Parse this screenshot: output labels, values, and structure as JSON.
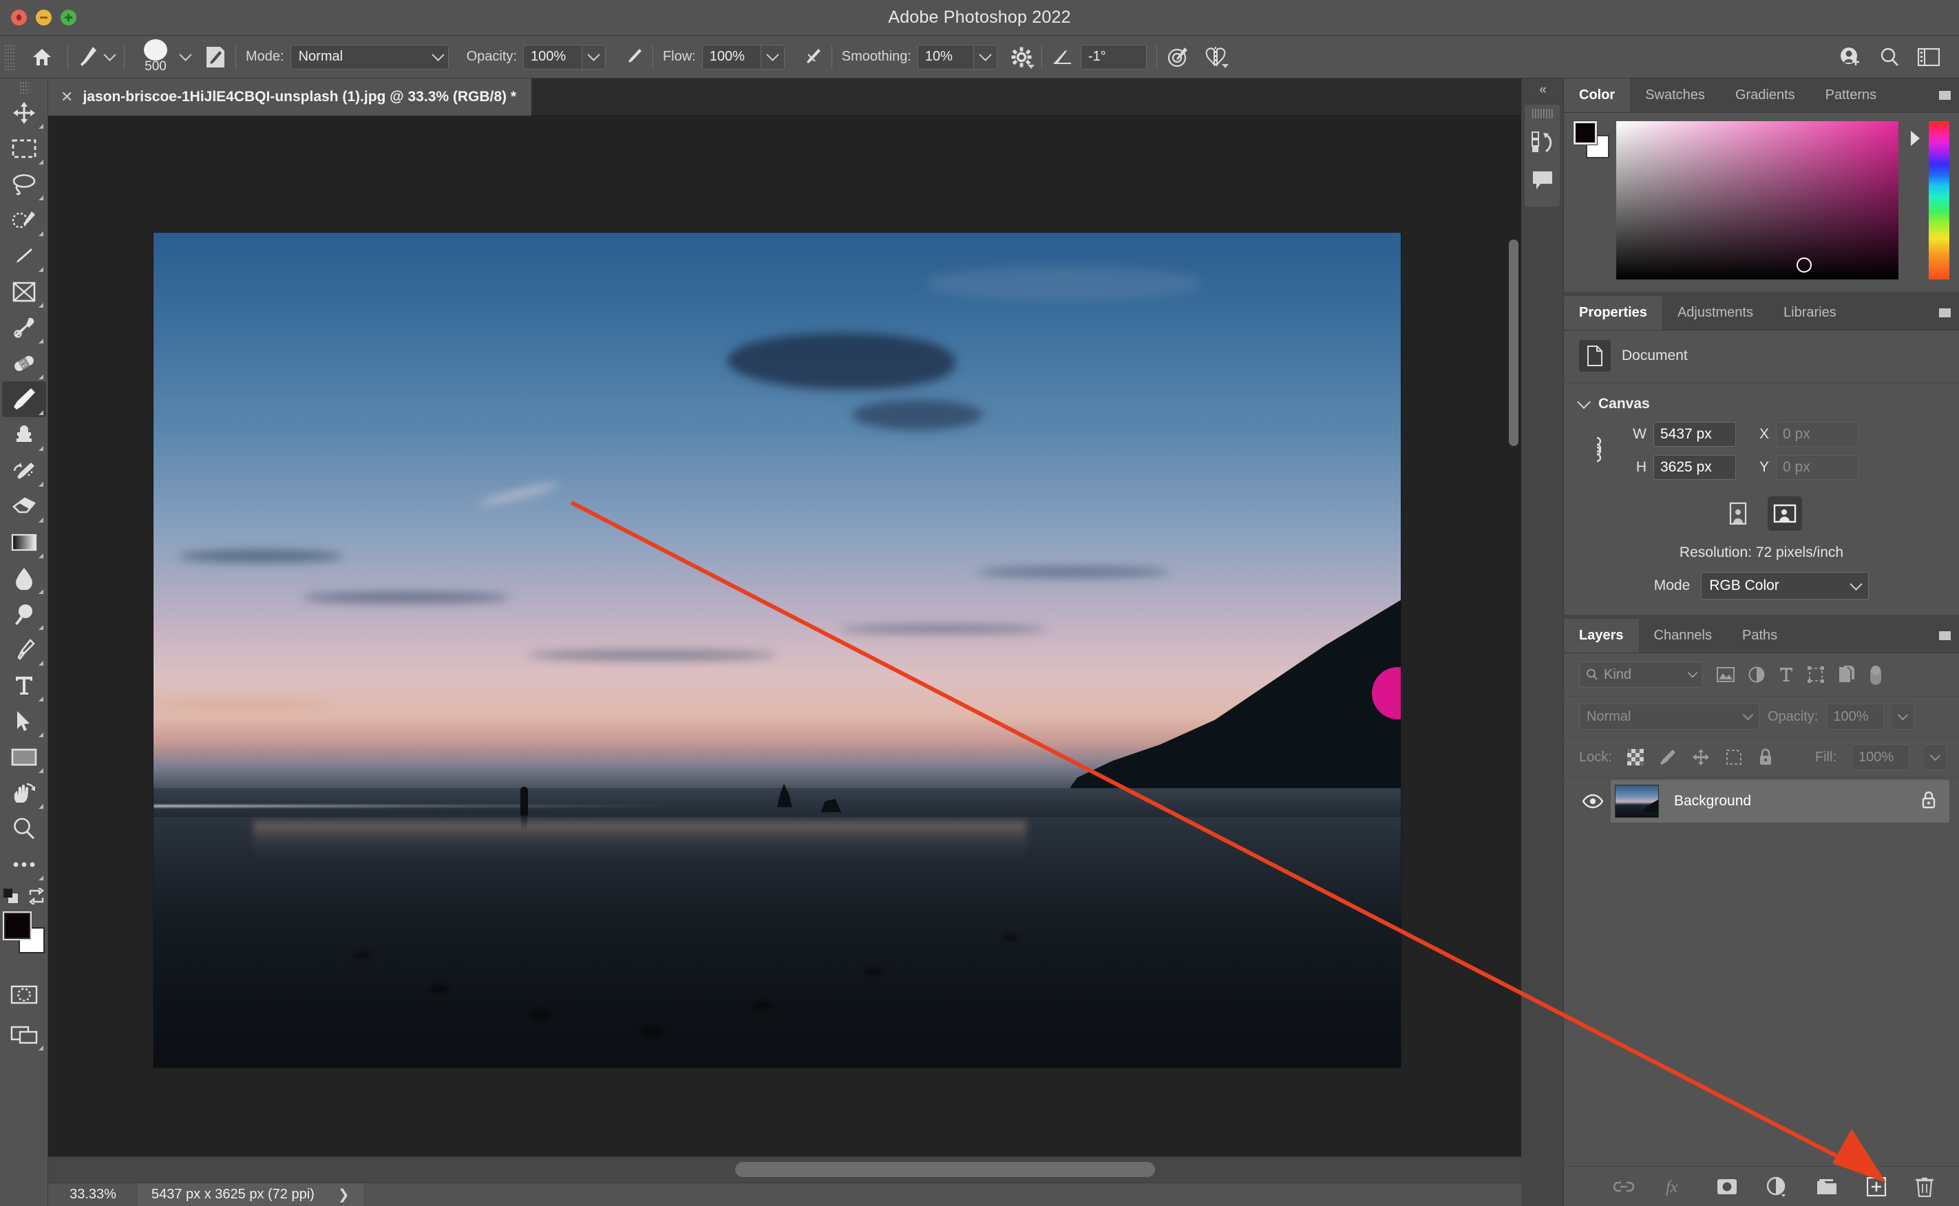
{
  "window": {
    "title": "Adobe Photoshop 2022",
    "controls": [
      "close",
      "minimize",
      "zoom"
    ]
  },
  "options_bar": {
    "home_icon": "home-icon",
    "brush_preset_icon": "brush-preset-icon",
    "brush_size": "500",
    "brush_panel_icon": "brush-settings-panel-icon",
    "mode_label": "Mode:",
    "mode_value": "Normal",
    "opacity_label": "Opacity:",
    "opacity_value": "100%",
    "pressure_opacity_icon": "pressure-opacity-icon",
    "flow_label": "Flow:",
    "flow_value": "100%",
    "airbrush_icon": "airbrush-icon",
    "smoothing_label": "Smoothing:",
    "smoothing_value": "10%",
    "smoothing_gear_icon": "smoothing-options-gear-icon",
    "angle_icon": "brush-angle-icon",
    "angle_value": "-1°",
    "pressure_size_icon": "pressure-size-icon",
    "symmetry_icon": "symmetry-butterfly-icon",
    "right_icons": [
      "share-add-user-icon",
      "search-icon",
      "workspace-switcher-icon"
    ]
  },
  "toolbar": {
    "tools": [
      {
        "name": "move-tool",
        "icon": "move-icon"
      },
      {
        "name": "rectangular-marquee-tool",
        "icon": "marquee-icon"
      },
      {
        "name": "lasso-tool",
        "icon": "lasso-icon"
      },
      {
        "name": "object-selection-tool",
        "icon": "quick-selection-icon"
      },
      {
        "name": "crop-tool",
        "icon": "crop-icon"
      },
      {
        "name": "frame-tool",
        "icon": "frame-icon"
      },
      {
        "name": "eyedropper-tool",
        "icon": "eyedropper-icon"
      },
      {
        "name": "spot-healing-brush-tool",
        "icon": "healing-bandage-icon"
      },
      {
        "name": "brush-tool",
        "icon": "brush-icon",
        "selected": true
      },
      {
        "name": "clone-stamp-tool",
        "icon": "stamp-icon"
      },
      {
        "name": "history-brush-tool",
        "icon": "history-brush-icon"
      },
      {
        "name": "eraser-tool",
        "icon": "eraser-icon"
      },
      {
        "name": "gradient-tool",
        "icon": "gradient-icon"
      },
      {
        "name": "blur-tool",
        "icon": "blur-droplet-icon"
      },
      {
        "name": "dodge-tool",
        "icon": "dodge-icon"
      },
      {
        "name": "pen-tool",
        "icon": "pen-icon"
      },
      {
        "name": "type-tool",
        "icon": "type-t-icon"
      },
      {
        "name": "path-selection-tool",
        "icon": "arrow-pointer-icon"
      },
      {
        "name": "rectangle-tool",
        "icon": "rectangle-icon"
      },
      {
        "name": "hand-tool",
        "icon": "hand-rotate-icon"
      },
      {
        "name": "zoom-tool",
        "icon": "magnifier-icon"
      },
      {
        "name": "edit-toolbar",
        "icon": "ellipsis-icon"
      }
    ],
    "foreground_color": "#0a0308",
    "background_color": "#ffffff",
    "swap_colors_icon": "swap-colors-icon",
    "default_colors_icon": "default-colors-icon",
    "quick_mask_icon": "quick-mask-icon",
    "screen_mode_icon": "screen-mode-icon"
  },
  "document": {
    "tab_title": "jason-briscoe-1HiJlE4CBQI-unsplash (1).jpg @ 33.3% (RGB/8) *",
    "close_icon": "close-tab-icon"
  },
  "status_bar": {
    "zoom": "33.33%",
    "dimensions": "5437 px x 3625 px (72 ppi)",
    "expand_icon": "chevron-right-icon"
  },
  "rail": {
    "collapse_icon": "collapse-panels-icon",
    "buttons": [
      {
        "name": "history-panel-button",
        "icon": "history-icon"
      },
      {
        "name": "comments-panel-button",
        "icon": "comment-bubble-icon"
      }
    ]
  },
  "color_panel": {
    "tabs": [
      {
        "label": "Color",
        "active": true
      },
      {
        "label": "Swatches",
        "active": false
      },
      {
        "label": "Gradients",
        "active": false
      },
      {
        "label": "Patterns",
        "active": false
      }
    ],
    "menu_icon": "panel-menu-icon",
    "foreground": "#0a0308",
    "background": "#ffffff",
    "picker_hue": "#e8299c",
    "marker_position": {
      "x_pct": 64,
      "y_pct": 86
    }
  },
  "properties_panel": {
    "tabs": [
      {
        "label": "Properties",
        "active": true
      },
      {
        "label": "Adjustments",
        "active": false
      },
      {
        "label": "Libraries",
        "active": false
      }
    ],
    "menu_icon": "panel-menu-icon",
    "document_row": {
      "icon": "document-icon",
      "label": "Document"
    },
    "canvas_section": {
      "title": "Canvas",
      "collapse_icon": "chevron-down-icon",
      "link_icon": "link-dimensions-icon",
      "w_label": "W",
      "w_value": "5437 px",
      "h_label": "H",
      "h_value": "3625 px",
      "x_label": "X",
      "x_placeholder": "0 px",
      "y_label": "Y",
      "y_placeholder": "0 px",
      "orientation_portrait_icon": "portrait-orientation-icon",
      "orientation_landscape_icon": "landscape-orientation-icon",
      "resolution": "Resolution: 72 pixels/inch",
      "mode_label": "Mode",
      "mode_value": "RGB Color"
    }
  },
  "layers_panel": {
    "tabs": [
      {
        "label": "Layers",
        "active": true
      },
      {
        "label": "Channels",
        "active": false
      },
      {
        "label": "Paths",
        "active": false
      }
    ],
    "menu_icon": "panel-menu-icon",
    "filter": {
      "kind_label": "Kind",
      "search_icon": "search-icon",
      "filters": [
        "filter-pixel-icon",
        "filter-adjustment-icon",
        "filter-type-icon",
        "filter-shape-icon",
        "filter-smart-object-icon"
      ],
      "toggle_icon": "filter-toggle-icon"
    },
    "blend_mode": "Normal",
    "opacity_label": "Opacity:",
    "opacity_value": "100%",
    "lock_label": "Lock:",
    "lock_icons": [
      "lock-transparent-pixels-icon",
      "lock-image-pixels-icon",
      "lock-position-icon",
      "lock-artboard-nesting-icon",
      "lock-all-icon"
    ],
    "fill_label": "Fill:",
    "fill_value": "100%",
    "layers": [
      {
        "name": "Background",
        "visible": true,
        "locked": true,
        "visibility_icon": "eye-icon",
        "lock_icon": "lock-icon"
      }
    ],
    "footer_icons": [
      {
        "name": "link-layers-button",
        "icon": "link-icon",
        "dim": true
      },
      {
        "name": "layer-style-button",
        "icon": "fx-icon",
        "dim": true
      },
      {
        "name": "add-layer-mask-button",
        "icon": "layer-mask-icon",
        "dim": false
      },
      {
        "name": "new-fill-adjustment-button",
        "icon": "adjustment-circle-icon",
        "dim": false
      },
      {
        "name": "new-group-button",
        "icon": "folder-icon",
        "dim": false
      },
      {
        "name": "new-layer-button",
        "icon": "plus-square-icon",
        "dim": false
      },
      {
        "name": "delete-layer-button",
        "icon": "trash-icon",
        "dim": false
      }
    ]
  },
  "annotation": {
    "arrow_color": "#e8401f",
    "points_to": "new-layer-button"
  },
  "canvas": {
    "image_alt": "beach-sunset-photo",
    "brush_cursor_color": "#d9148c"
  }
}
